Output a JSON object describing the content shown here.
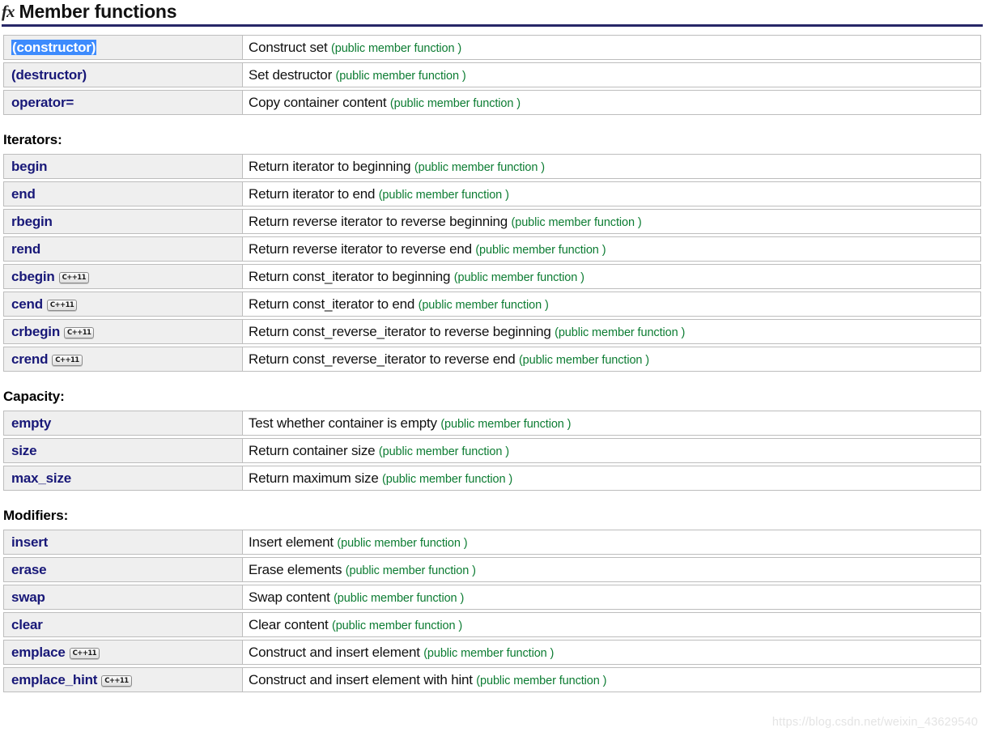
{
  "header": {
    "icon": "fx-icon",
    "icon_text": "fx",
    "title": "Member functions",
    "rule_color": "#262667"
  },
  "colors": {
    "link": "#181878",
    "note_green": "#0c7c32",
    "selection_blue": "#3d8bfd",
    "name_cell_bg": "#efefef",
    "border": "#bdbdbd"
  },
  "badge_label": "C++11",
  "note_suffix": "(public member function )",
  "sections": [
    {
      "label": "",
      "rows": [
        {
          "name": "(constructor)",
          "badge": false,
          "selected": true,
          "desc": "Construct set",
          "note": "(public member function )"
        },
        {
          "name": "(destructor)",
          "badge": false,
          "selected": false,
          "desc": "Set destructor",
          "note": "(public member function )"
        },
        {
          "name": "operator=",
          "badge": false,
          "selected": false,
          "desc": "Copy container content",
          "note": "(public member function )"
        }
      ]
    },
    {
      "label": "Iterators:",
      "rows": [
        {
          "name": "begin",
          "badge": false,
          "selected": false,
          "desc": "Return iterator to beginning",
          "note": "(public member function )"
        },
        {
          "name": "end",
          "badge": false,
          "selected": false,
          "desc": "Return iterator to end",
          "note": "(public member function )"
        },
        {
          "name": "rbegin",
          "badge": false,
          "selected": false,
          "desc": "Return reverse iterator to reverse beginning",
          "note": "(public member function )"
        },
        {
          "name": "rend",
          "badge": false,
          "selected": false,
          "desc": "Return reverse iterator to reverse end",
          "note": "(public member function )"
        },
        {
          "name": "cbegin",
          "badge": true,
          "selected": false,
          "desc": "Return const_iterator to beginning",
          "note": "(public member function )"
        },
        {
          "name": "cend",
          "badge": true,
          "selected": false,
          "desc": "Return const_iterator to end",
          "note": "(public member function )"
        },
        {
          "name": "crbegin",
          "badge": true,
          "selected": false,
          "desc": "Return const_reverse_iterator to reverse beginning",
          "note": "(public member function )"
        },
        {
          "name": "crend",
          "badge": true,
          "selected": false,
          "desc": "Return const_reverse_iterator to reverse end",
          "note": "(public member function )"
        }
      ]
    },
    {
      "label": "Capacity:",
      "rows": [
        {
          "name": "empty",
          "badge": false,
          "selected": false,
          "desc": "Test whether container is empty",
          "note": "(public member function )"
        },
        {
          "name": "size",
          "badge": false,
          "selected": false,
          "desc": "Return container size",
          "note": "(public member function )"
        },
        {
          "name": "max_size",
          "badge": false,
          "selected": false,
          "desc": "Return maximum size",
          "note": "(public member function )"
        }
      ]
    },
    {
      "label": "Modifiers:",
      "rows": [
        {
          "name": "insert",
          "badge": false,
          "selected": false,
          "desc": "Insert element",
          "note": "(public member function )"
        },
        {
          "name": "erase",
          "badge": false,
          "selected": false,
          "desc": "Erase elements",
          "note": "(public member function )"
        },
        {
          "name": "swap",
          "badge": false,
          "selected": false,
          "desc": "Swap content",
          "note": "(public member function )"
        },
        {
          "name": "clear",
          "badge": false,
          "selected": false,
          "desc": "Clear content",
          "note": "(public member function )"
        },
        {
          "name": "emplace",
          "badge": true,
          "selected": false,
          "desc": "Construct and insert element",
          "note": "(public member function )"
        },
        {
          "name": "emplace_hint",
          "badge": true,
          "selected": false,
          "desc": "Construct and insert element with hint",
          "note": "(public member function )"
        }
      ]
    }
  ],
  "watermark": "https://blog.csdn.net/weixin_43629540"
}
